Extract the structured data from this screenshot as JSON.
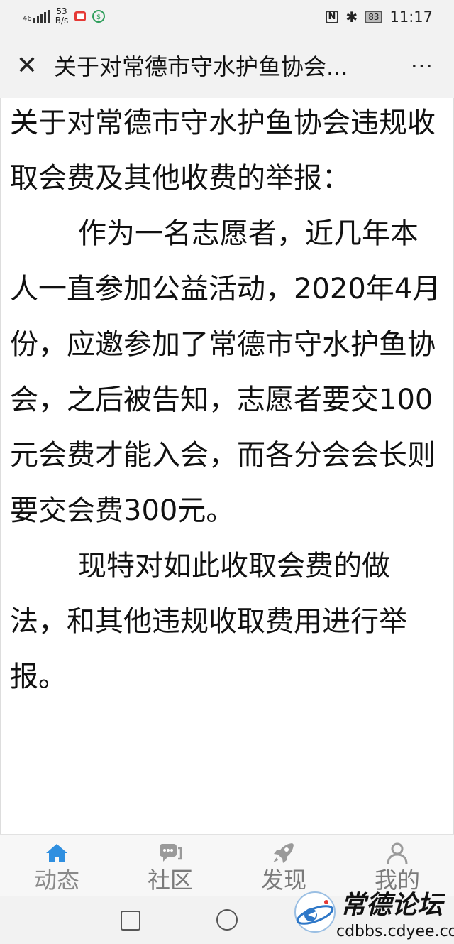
{
  "status_bar": {
    "network": "46",
    "speed_value": "53",
    "speed_unit": "B/s",
    "nfc": "N",
    "bluetooth": "✱",
    "battery": "83",
    "time": "11:17"
  },
  "title_bar": {
    "close_glyph": "✕",
    "title": "关于对常德市守水护鱼协会...",
    "more_glyph": "⋯"
  },
  "article": {
    "paragraphs": [
      "关于对常德市守水护鱼协会违规收取会费及其他收费的举报：",
      "作为一名志愿者，近几年本人一直参加公益活动，2020年4月份，应邀参加了常德市守水护鱼协会，之后被告知，志愿者要交100元会费才能入会，而各分会会长则要交会费300元。",
      "现特对如此收取会费的做法，和其他违规收取费用进行举报。"
    ]
  },
  "tab_bar": {
    "tabs": [
      {
        "label": "动态",
        "icon": "home-icon"
      },
      {
        "label": "社区",
        "icon": "chat-icon"
      },
      {
        "label": "发现",
        "icon": "rocket-icon"
      },
      {
        "label": "我的",
        "icon": "user-icon"
      }
    ],
    "active_color": "#2f8fe0",
    "inactive_color": "#9a9a9a"
  },
  "watermark": {
    "title": "常德论坛",
    "url": "cdbbs.cdyee.com"
  }
}
